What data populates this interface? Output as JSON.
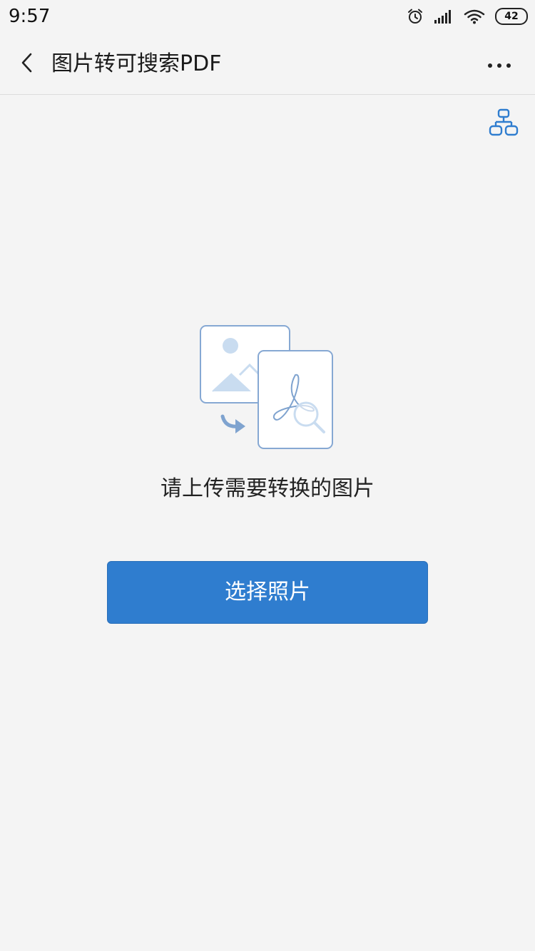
{
  "status_bar": {
    "time": "9:57",
    "battery_level": "42",
    "icons": [
      "alarm-icon",
      "signal-icon",
      "wifi-icon",
      "battery-icon"
    ]
  },
  "header": {
    "title": "图片转可搜索PDF",
    "back_icon": "back-arrow-icon",
    "more_icon": "more-dots-icon"
  },
  "toolbar": {
    "org_icon": "hierarchy-icon"
  },
  "main": {
    "illustration_icon": "image-to-pdf-illustration",
    "prompt": "请上传需要转换的图片",
    "select_button_label": "选择照片"
  },
  "colors": {
    "accent": "#2f7dcf",
    "background": "#f4f4f4",
    "illustration_line": "#7fa3cf",
    "illustration_fill": "#c9dcf0"
  }
}
